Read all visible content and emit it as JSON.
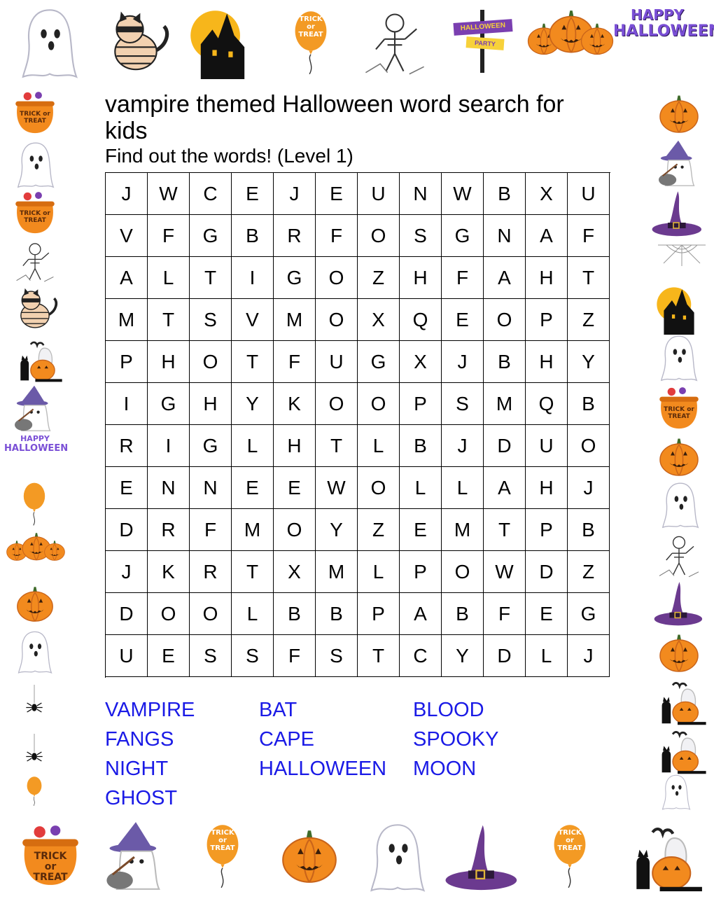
{
  "page": {
    "title": "vampire themed Halloween word search for kids",
    "subtitle": "Find out the words! (Level 1)"
  },
  "grid": [
    [
      "J",
      "W",
      "C",
      "E",
      "J",
      "E",
      "U",
      "N",
      "W",
      "B",
      "X",
      "U"
    ],
    [
      "V",
      "F",
      "G",
      "B",
      "R",
      "F",
      "O",
      "S",
      "G",
      "N",
      "A",
      "F"
    ],
    [
      "A",
      "L",
      "T",
      "I",
      "G",
      "O",
      "Z",
      "H",
      "F",
      "A",
      "H",
      "T"
    ],
    [
      "M",
      "T",
      "S",
      "V",
      "M",
      "O",
      "X",
      "Q",
      "E",
      "O",
      "P",
      "Z"
    ],
    [
      "P",
      "H",
      "O",
      "T",
      "F",
      "U",
      "G",
      "X",
      "J",
      "B",
      "H",
      "Y"
    ],
    [
      "I",
      "G",
      "H",
      "Y",
      "K",
      "O",
      "O",
      "P",
      "S",
      "M",
      "Q",
      "B"
    ],
    [
      "R",
      "I",
      "G",
      "L",
      "H",
      "T",
      "L",
      "B",
      "J",
      "D",
      "U",
      "O"
    ],
    [
      "E",
      "N",
      "N",
      "E",
      "E",
      "W",
      "O",
      "L",
      "L",
      "A",
      "H",
      "J"
    ],
    [
      "D",
      "R",
      "F",
      "M",
      "O",
      "Y",
      "Z",
      "E",
      "M",
      "T",
      "P",
      "B"
    ],
    [
      "J",
      "K",
      "R",
      "T",
      "X",
      "M",
      "L",
      "P",
      "O",
      "W",
      "D",
      "Z"
    ],
    [
      "D",
      "O",
      "O",
      "L",
      "B",
      "B",
      "P",
      "A",
      "B",
      "F",
      "E",
      "G"
    ],
    [
      "U",
      "E",
      "S",
      "S",
      "F",
      "S",
      "T",
      "C",
      "Y",
      "D",
      "L",
      "J"
    ]
  ],
  "word_list": [
    "VAMPIRE",
    "BAT",
    "BLOOD",
    "FANGS",
    "CAPE",
    "SPOOKY",
    "NIGHT",
    "HALLOWEEN",
    "MOON",
    "GHOST"
  ],
  "decorations": {
    "badge_trick": "TRICK or TREAT",
    "badge_happy_1": "HAPPY",
    "badge_happy_2": "HALLOWEEN",
    "sign_top": "HALLOWEEN",
    "sign_bottom": "PARTY"
  },
  "colors": {
    "word_blue": "#1a1ae6",
    "pumpkin": "#f28a1e",
    "witch_purple": "#6b3a8f",
    "ghost_outline": "#b8b8c8"
  }
}
